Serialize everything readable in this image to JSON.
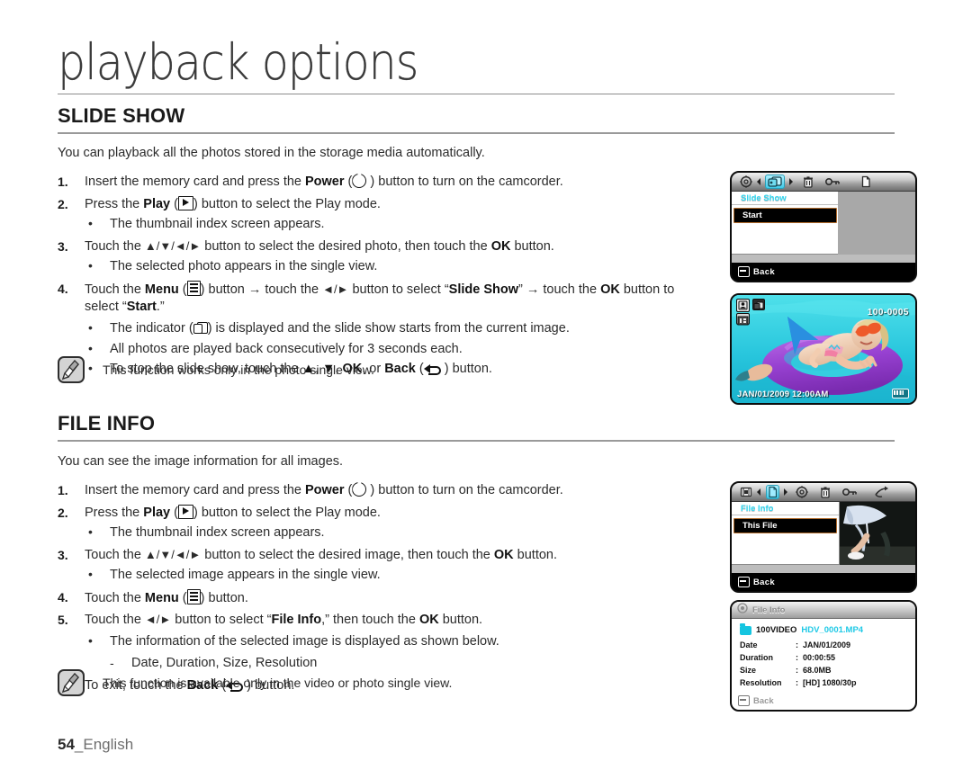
{
  "chapter": {
    "title": "playback options"
  },
  "footer": {
    "page": "54",
    "sep": "_",
    "language": "English"
  },
  "sections": [
    {
      "id": "slide-show",
      "heading": "SLIDE SHOW",
      "lead": "You can playback all the photos stored in the storage media automatically.",
      "steps": [
        {
          "num": "1.",
          "text_a": "Insert the memory card and press the ",
          "bold_a": "Power",
          "icon": "power-icon",
          "text_b": " button to turn on the camcorder."
        },
        {
          "num": "2.",
          "text_a": "Press the ",
          "bold_a": "Play",
          "icon": "play-icon",
          "text_b": " button to select the Play mode."
        },
        {
          "num": "3.",
          "text_a": "Touch the ",
          "arrows": "▲/▼/◄/►",
          "text_b": " button to select the desired photo, then touch the ",
          "bold_b": "OK",
          "text_c": " button."
        },
        {
          "num": "4.",
          "text_a": "Touch the ",
          "bold_a": "Menu",
          "icon": "menu-icon",
          "text_b": " button → touch the ",
          "arrows": "◄/►",
          "text_c": " button to select “",
          "bold_b": "Slide Show",
          "text_d": "” → touch the ",
          "bold_c": "OK",
          "text_e": " button to select “",
          "bold_d": "Start",
          "text_f": ".”"
        }
      ],
      "bullets": [
        {
          "after_step": "2.",
          "text": "The thumbnail index screen appears."
        },
        {
          "after_step": "3.",
          "text": "The selected photo appears in the single view."
        },
        {
          "after_step": "4a",
          "text_a": "The indicator (",
          "icon": "slideshow-icon",
          "text_b": ") is displayed and the slide show starts from the current image."
        },
        {
          "after_step": "4b",
          "text": "All photos are played back consecutively for 3 seconds each."
        },
        {
          "after_step": "4c",
          "text_a": "To stop the slide show, touch the ",
          "bold_a": "▲",
          "text_b": ", ",
          "bold_b": "▼",
          "text_c": ", ",
          "bold_c": "OK",
          "text_d": ", or ",
          "bold_d": "Back",
          "icon": "back-icon",
          "text_e": " button."
        }
      ],
      "note": "This function works only in the photo single view."
    },
    {
      "id": "file-info",
      "heading": "FILE INFO",
      "lead": "You can see the image information for all images.",
      "steps": [
        {
          "num": "1.",
          "text_a": "Insert the memory card and press the ",
          "bold_a": "Power",
          "icon": "power-icon",
          "text_b": " button to turn on the camcorder."
        },
        {
          "num": "2.",
          "text_a": "Press the ",
          "bold_a": "Play",
          "icon": "play-icon",
          "text_b": " button to select the Play mode."
        },
        {
          "num": "3.",
          "text_a": "Touch the ",
          "arrows": "▲/▼/◄/►",
          "text_b": " button to select the desired image, then touch the ",
          "bold_b": "OK",
          "text_c": " button."
        },
        {
          "num": "4.",
          "text_a": "Touch the ",
          "bold_a": "Menu",
          "icon": "menu-icon",
          "text_b": " button."
        },
        {
          "num": "5.",
          "text_a": "Touch the ",
          "arrows": "◄/►",
          "text_b": " button to select “",
          "bold_b": "File Info",
          "text_c": ",” then touch the ",
          "bold_c": "OK",
          "text_d": " button."
        },
        {
          "num": "6.",
          "text_a": "To exit, touch the ",
          "bold_a": "Back",
          "icon": "back-icon",
          "text_b": " button."
        }
      ],
      "bullets": [
        {
          "after_step": "2.",
          "text": "The thumbnail index screen appears."
        },
        {
          "after_step": "3.",
          "text": "The selected image appears in the single view."
        },
        {
          "after_step": "5.",
          "text": "The information of the selected image is displayed as shown below."
        }
      ],
      "sub_bullets": [
        {
          "text": "Date, Duration, Size, Resolution"
        }
      ],
      "note": "This function is available only in the video or photo single view."
    }
  ],
  "screens": {
    "slide_show_menu": {
      "name": "slide-show-menu-screen",
      "icons": [
        "gear-icon",
        "left-arrow-icon",
        "slideshow-icon",
        "right-arrow-icon",
        "trash-icon",
        "key-icon",
        "file-icon"
      ],
      "selected_icon": "slideshow-icon",
      "heading": "Slide Show",
      "selected_item": "Start",
      "back_label": "Back"
    },
    "photo_view": {
      "name": "photo-single-view-screen",
      "file_number": "100-0005",
      "datetime": "JAN/01/2009 12:00AM",
      "icons": [
        "photo-mode-icon",
        "slideshow-indicator-icon",
        "resolution-badge-icon",
        "battery-icon"
      ]
    },
    "file_info_menu": {
      "name": "file-info-menu-screen",
      "icons": [
        "edit-icon",
        "left-arrow-icon",
        "file-icon",
        "right-arrow-icon",
        "gear-icon",
        "trash-icon",
        "key-icon",
        "share-icon"
      ],
      "selected_icon": "file-icon",
      "heading": "File Info",
      "selected_item": "This File",
      "back_label": "Back"
    },
    "file_info_panel": {
      "name": "file-info-detail-panel",
      "title": "File Info",
      "folder": "100VIDEO",
      "filename": "HDV_0001.MP4",
      "rows": [
        {
          "key": "Date",
          "sep": ":",
          "value": "JAN/01/2009"
        },
        {
          "key": "Duration",
          "sep": ":",
          "value": "00:00:55"
        },
        {
          "key": "Size",
          "sep": ":",
          "value": "68.0MB"
        },
        {
          "key": "Resolution",
          "sep": ":",
          "value": "[HD]  1080/30p"
        }
      ],
      "back_label": "Back"
    }
  },
  "colors": {
    "cyan": "#2fd8f2",
    "selection_border": "#b06a2a",
    "pool_water": "#33d1e0",
    "float_purple": "#9b4fd4"
  }
}
